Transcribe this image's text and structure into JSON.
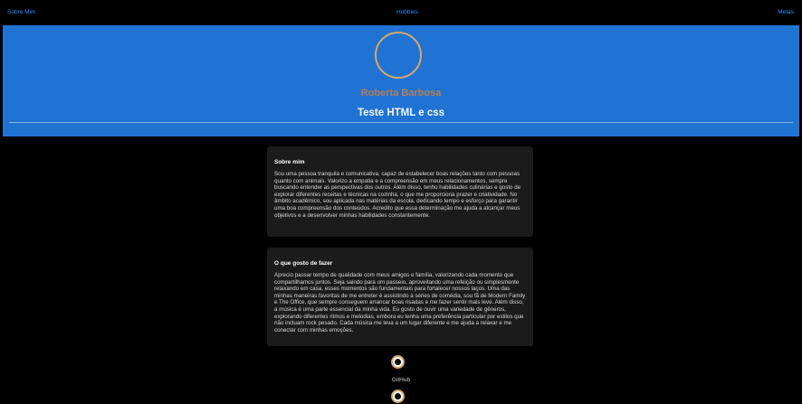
{
  "nav": {
    "about": "Sobre Mim",
    "hobbies": "Hobbies",
    "goals": "Metas"
  },
  "hero": {
    "name": "Roberta Barbosa",
    "title": "Teste HTML e css"
  },
  "about": {
    "heading": "Sobre mim",
    "text": "Sou uma pessoa tranquila e comunicativa, capaz de estabelecer boas relações tanto com pessoas quanto com animais. Valorizo a empatia e a compreensão em meus relacionamentos, sempre buscando entender as perspectivas dos outros. Além disso, tenho habilidades culinárias e gosto de explorar diferentes receitas e técnicas na cozinha, o que me proporciona prazer e criatividade. No âmbito acadêmico, sou aplicada nas matérias da escola, dedicando tempo e esforço para garantir uma boa compreensão dos conteúdos. Acredito que essa determinação me ajuda a alcançar meus objetivos e a desenvolver minhas habilidades constantemente."
  },
  "hobbies": {
    "heading": "O que gosto de fazer",
    "text": "Aprecio passar tempo de qualidade com meus amigos e família, valorizando cada momento que compartilhamos juntos. Seja saindo para um passeio, aproveitando uma refeição ou simplesmente relaxando em casa, esses momentos são fundamentais para fortalecer nossos laços. Uma das minhas maneiras favoritas de me entreter é assistindo à séries de comédia, sou fã de Modern Family e The Office, que sempre conseguem arrancar boas risadas e me fazer sentir mais leve. Além disso, a música é uma parte essencial da minha vida. Eu gosto de ouvir uma variedade de gêneros, explorando diferentes ritmos e melodias, embora eu tenha uma preferência particular por estilos que não incluam rock pesado. Cada música me leva a um lugar diferente e me ajuda a relaxar e me conectar com minhas emoções."
  },
  "social": {
    "github_label": "GitHub",
    "github_icon": "github-icon",
    "second_icon": "social-icon"
  },
  "colors": {
    "hero_bg": "#2173d3",
    "accent": "#d5a86b",
    "link": "#2f8fff"
  }
}
